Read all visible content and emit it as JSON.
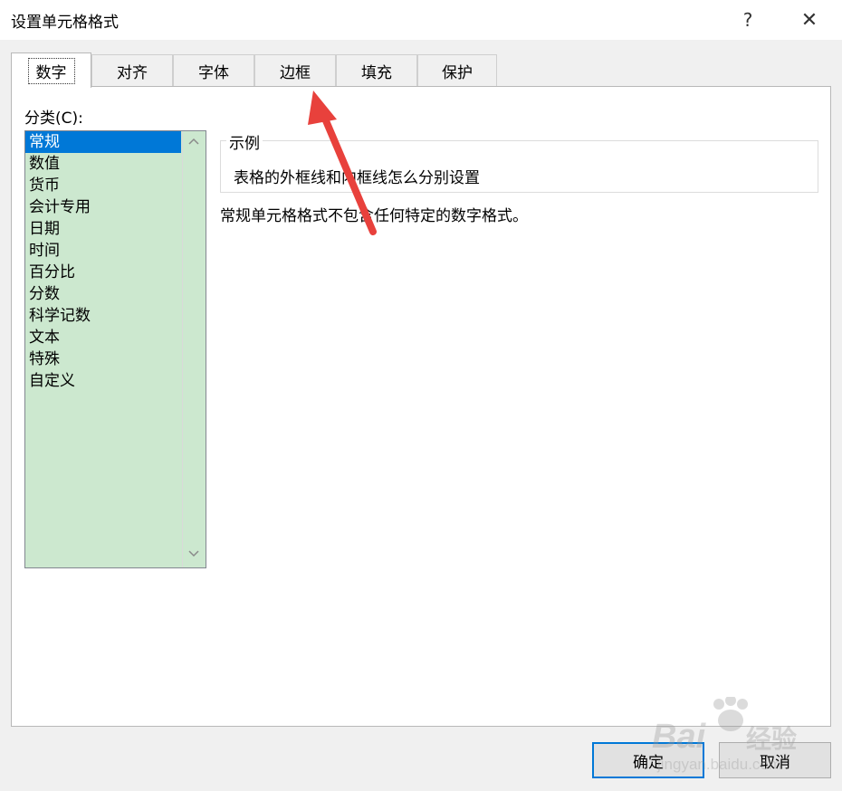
{
  "window": {
    "title": "设置单元格格式",
    "help_label": "?",
    "close_label": "✕"
  },
  "tabs": [
    {
      "label": "数字",
      "active": true
    },
    {
      "label": "对齐",
      "active": false
    },
    {
      "label": "字体",
      "active": false
    },
    {
      "label": "边框",
      "active": false
    },
    {
      "label": "填充",
      "active": false
    },
    {
      "label": "保护",
      "active": false
    }
  ],
  "category": {
    "label": "分类(C):",
    "selected": "常规",
    "items": [
      "常规",
      "数值",
      "货币",
      "会计专用",
      "日期",
      "时间",
      "百分比",
      "分数",
      "科学记数",
      "文本",
      "特殊",
      "自定义"
    ]
  },
  "sample": {
    "legend": "示例",
    "text": "表格的外框线和内框线怎么分别设置"
  },
  "description": "常规单元格格式不包含任何特定的数字格式。",
  "buttons": {
    "ok": "确定",
    "cancel": "取消"
  },
  "watermark": {
    "logo": "Baidu经验",
    "url": "jingyan.baidu.com"
  },
  "colors": {
    "selection": "#0078d7",
    "list_bg": "#cce8cf",
    "annotation_arrow": "#e8413c",
    "ok_border": "#0078d7"
  }
}
